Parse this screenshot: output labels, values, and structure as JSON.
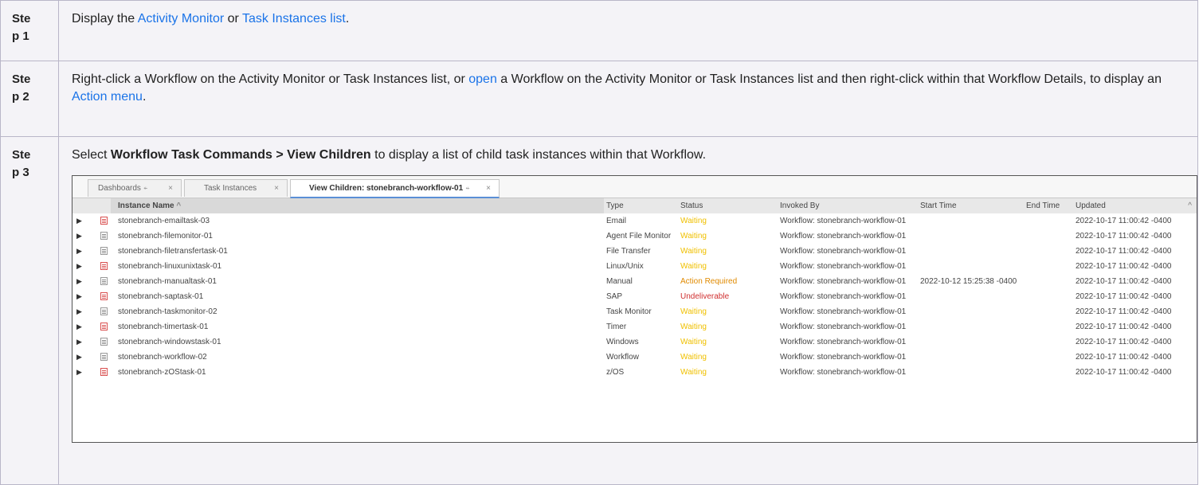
{
  "steps": [
    {
      "label_a": "Ste",
      "label_b": "p 1"
    },
    {
      "label_a": "Ste",
      "label_b": "p 2"
    },
    {
      "label_a": "Ste",
      "label_b": "p 3"
    }
  ],
  "step1": {
    "t1": "Display the ",
    "link1": "Activity Monitor",
    "t2": " or ",
    "link2": "Task Instances list",
    "t3": "."
  },
  "step2": {
    "t1": "Right-click a Workflow on the Activity Monitor or Task Instances list, or ",
    "link1": "open",
    "t2": " a Workflow on the Activity Monitor or Task Instances list and then right-click within that Workflow Details, to display an ",
    "link2": "Action menu",
    "t3": "."
  },
  "step3": {
    "t1": "Select ",
    "bold": "Workflow Task Commands > View Children",
    "t2": " to display a list of child task instances within that Workflow."
  },
  "tabs": [
    {
      "label": "Dashboards",
      "pin": "⍅",
      "close": "×"
    },
    {
      "label": "Task Instances",
      "close": "×"
    },
    {
      "label": "View Children: stonebranch-workflow-01",
      "pin": "⍅",
      "close": "×"
    }
  ],
  "columns": {
    "name": "Instance Name",
    "sort_caret": "^",
    "type": "Type",
    "status": "Status",
    "invoked": "Invoked By",
    "start": "Start Time",
    "end": "End Time",
    "updated": "Updated",
    "scroll": "^"
  },
  "rows": [
    {
      "name": "stonebranch-emailtask-03",
      "icon": "red",
      "type": "Email",
      "status": "Waiting",
      "status_kind": "wait",
      "invoked": "Workflow: stonebranch-workflow-01",
      "start": "",
      "end": "",
      "updated": "2022-10-17 11:00:42 -0400"
    },
    {
      "name": "stonebranch-filemonitor-01",
      "icon": "grey",
      "type": "Agent File Monitor",
      "status": "Waiting",
      "status_kind": "wait",
      "invoked": "Workflow: stonebranch-workflow-01",
      "start": "",
      "end": "",
      "updated": "2022-10-17 11:00:42 -0400"
    },
    {
      "name": "stonebranch-filetransfertask-01",
      "icon": "grey",
      "type": "File Transfer",
      "status": "Waiting",
      "status_kind": "wait",
      "invoked": "Workflow: stonebranch-workflow-01",
      "start": "",
      "end": "",
      "updated": "2022-10-17 11:00:42 -0400"
    },
    {
      "name": "stonebranch-linuxunixtask-01",
      "icon": "red",
      "type": "Linux/Unix",
      "status": "Waiting",
      "status_kind": "wait",
      "invoked": "Workflow: stonebranch-workflow-01",
      "start": "",
      "end": "",
      "updated": "2022-10-17 11:00:42 -0400"
    },
    {
      "name": "stonebranch-manualtask-01",
      "icon": "grey",
      "type": "Manual",
      "status": "Action Required",
      "status_kind": "act",
      "invoked": "Workflow: stonebranch-workflow-01",
      "start": "2022-10-12 15:25:38 -0400",
      "end": "",
      "updated": "2022-10-17 11:00:42 -0400"
    },
    {
      "name": "stonebranch-saptask-01",
      "icon": "red",
      "type": "SAP",
      "status": "Undeliverable",
      "status_kind": "und",
      "invoked": "Workflow: stonebranch-workflow-01",
      "start": "",
      "end": "",
      "updated": "2022-10-17 11:00:42 -0400"
    },
    {
      "name": "stonebranch-taskmonitor-02",
      "icon": "grey",
      "type": "Task Monitor",
      "status": "Waiting",
      "status_kind": "wait",
      "invoked": "Workflow: stonebranch-workflow-01",
      "start": "",
      "end": "",
      "updated": "2022-10-17 11:00:42 -0400"
    },
    {
      "name": "stonebranch-timertask-01",
      "icon": "red",
      "type": "Timer",
      "status": "Waiting",
      "status_kind": "wait",
      "invoked": "Workflow: stonebranch-workflow-01",
      "start": "",
      "end": "",
      "updated": "2022-10-17 11:00:42 -0400"
    },
    {
      "name": "stonebranch-windowstask-01",
      "icon": "grey",
      "type": "Windows",
      "status": "Waiting",
      "status_kind": "wait",
      "invoked": "Workflow: stonebranch-workflow-01",
      "start": "",
      "end": "",
      "updated": "2022-10-17 11:00:42 -0400"
    },
    {
      "name": "stonebranch-workflow-02",
      "icon": "grey",
      "type": "Workflow",
      "status": "Waiting",
      "status_kind": "wait",
      "invoked": "Workflow: stonebranch-workflow-01",
      "start": "",
      "end": "",
      "updated": "2022-10-17 11:00:42 -0400"
    },
    {
      "name": "stonebranch-zOStask-01",
      "icon": "red",
      "type": "z/OS",
      "status": "Waiting",
      "status_kind": "wait",
      "invoked": "Workflow: stonebranch-workflow-01",
      "start": "",
      "end": "",
      "updated": "2022-10-17 11:00:42 -0400"
    }
  ],
  "colors": {
    "link": "#1a73e8",
    "waiting": "#f0c000",
    "action_required": "#e08a00",
    "undeliverable": "#d03030"
  }
}
